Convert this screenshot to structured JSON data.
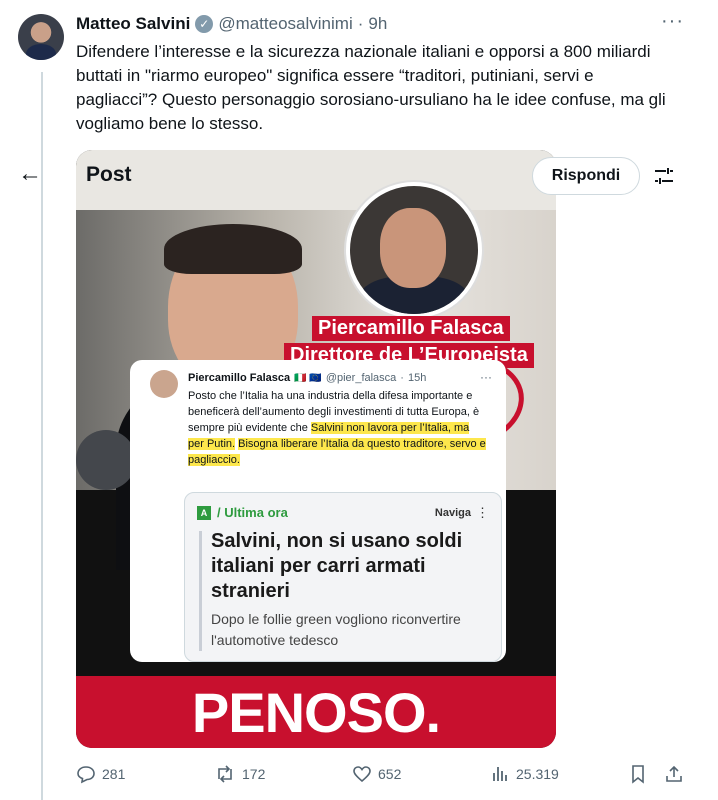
{
  "tweet": {
    "author_name": "Matteo Salvini",
    "handle": "@matteosalvinimi",
    "separator": "·",
    "time": "9h",
    "more": "···",
    "text": "Difendere l’interesse e la sicurezza nazionale italiani e opporsi a 800 miliardi buttati in \"riarmo europeo\" significa essere “traditori, putiniani, servi e pagliacci”? Questo personaggio sorosiano-ursuliano ha le idee confuse, ma gli vogliamo bene lo stesso."
  },
  "overlay": {
    "back_icon": "arrow-left-icon",
    "post_title": "Post",
    "reply_button": "Rispondi",
    "filter_icon": "sliders-icon"
  },
  "media": {
    "caption_name": "Piercamillo Falasca",
    "caption_role": "Direttore de L’Europeista",
    "inner_tweet": {
      "name": "Piercamillo Falasca",
      "flags": "🇮🇹 🇪🇺",
      "handle": "@pier_falasca",
      "time": "15h",
      "more": "···",
      "text_plain": "Posto che l’Italia ha una industria della difesa importante e beneficerà dell’aumento degli investimenti di tutta Europa, è sempre più evidente che ",
      "text_highlight_1": "Salvini non lavora per l’Italia, ma per Putin.",
      "text_highlight_2": "Bisogna liberare l’Italia da questo traditore, servo e pagliaccio."
    },
    "news_card": {
      "logo": "A",
      "tag": "/ Ultima ora",
      "nav": "Naviga",
      "headline": "Salvini, non si usano soldi italiani per carri armati stranieri",
      "subhead": "Dopo le follie green vogliono riconvertire l'automotive tedesco"
    },
    "banner": "PENOSO."
  },
  "actions": {
    "replies": "281",
    "reposts": "172",
    "likes": "652",
    "views": "25.319"
  }
}
